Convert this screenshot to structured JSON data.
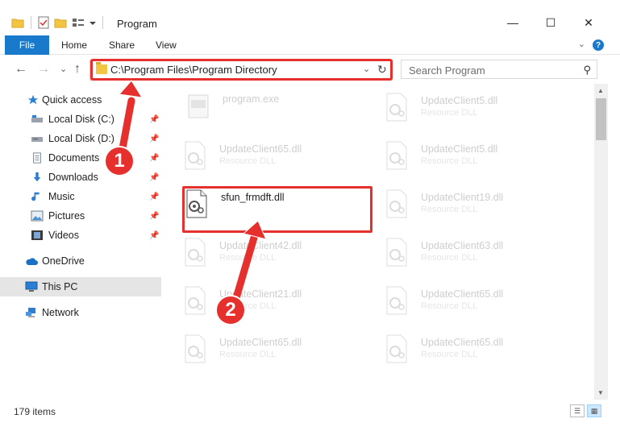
{
  "window": {
    "title": "Program",
    "minimize_glyph": "—",
    "maximize_glyph": "☐",
    "close_glyph": "✕"
  },
  "ribbon": {
    "tabs": [
      "File",
      "Home",
      "Share",
      "View"
    ],
    "help_glyph": "?",
    "expand_glyph": "⌄"
  },
  "nav": {
    "back_glyph": "←",
    "forward_glyph": "→",
    "recent_glyph": "⌄",
    "up_glyph": "↑"
  },
  "address": {
    "path": "C:\\Program Files\\Program Directory",
    "dropdown_glyph": "⌄",
    "refresh_glyph": "↻"
  },
  "search": {
    "placeholder": "Search Program",
    "icon_glyph": "⚲"
  },
  "sidebar": {
    "items": [
      {
        "label": "Quick access",
        "icon": "star-icon",
        "pinned": false
      },
      {
        "label": "Local Disk (C:)",
        "icon": "drive-icon",
        "pinned": true
      },
      {
        "label": "Local Disk (D:)",
        "icon": "drive-icon",
        "pinned": true
      },
      {
        "label": "Documents",
        "icon": "documents-icon",
        "pinned": true
      },
      {
        "label": "Downloads",
        "icon": "download-icon",
        "pinned": true
      },
      {
        "label": "Music",
        "icon": "music-icon",
        "pinned": true
      },
      {
        "label": "Pictures",
        "icon": "pictures-icon",
        "pinned": true
      },
      {
        "label": "Videos",
        "icon": "videos-icon",
        "pinned": true
      },
      {
        "label": "OneDrive",
        "icon": "cloud-icon",
        "pinned": false
      },
      {
        "label": "This PC",
        "icon": "computer-icon",
        "pinned": false,
        "selected": true
      },
      {
        "label": "Network",
        "icon": "network-icon",
        "pinned": false
      }
    ]
  },
  "files": [
    {
      "name": "program.exe",
      "type": ""
    },
    {
      "name": "UpdateClient5.dll",
      "type": "Resource DLL"
    },
    {
      "name": "UpdateClient65.dll",
      "type": "Resource DLL"
    },
    {
      "name": "UpdateClient5.dll",
      "type": "Resource DLL"
    },
    {
      "name": "sfun_frmdft.dll",
      "type": "",
      "highlighted": true
    },
    {
      "name": "UpdateClient19.dll",
      "type": "Resource DLL"
    },
    {
      "name": "UpdateClient42.dll",
      "type": "Resource DLL"
    },
    {
      "name": "UpdateClient63.dll",
      "type": "Resource DLL"
    },
    {
      "name": "UpdateClient21.dll",
      "type": "Resource DLL"
    },
    {
      "name": "UpdateClient65.dll",
      "type": "Resource DLL"
    },
    {
      "name": "UpdateClient65.dll",
      "type": "Resource DLL"
    },
    {
      "name": "UpdateClient65.dll",
      "type": "Resource DLL"
    }
  ],
  "status": {
    "item_count": "179 items"
  },
  "annotations": {
    "step1": "1",
    "step2": "2",
    "color": "#e5302e"
  }
}
